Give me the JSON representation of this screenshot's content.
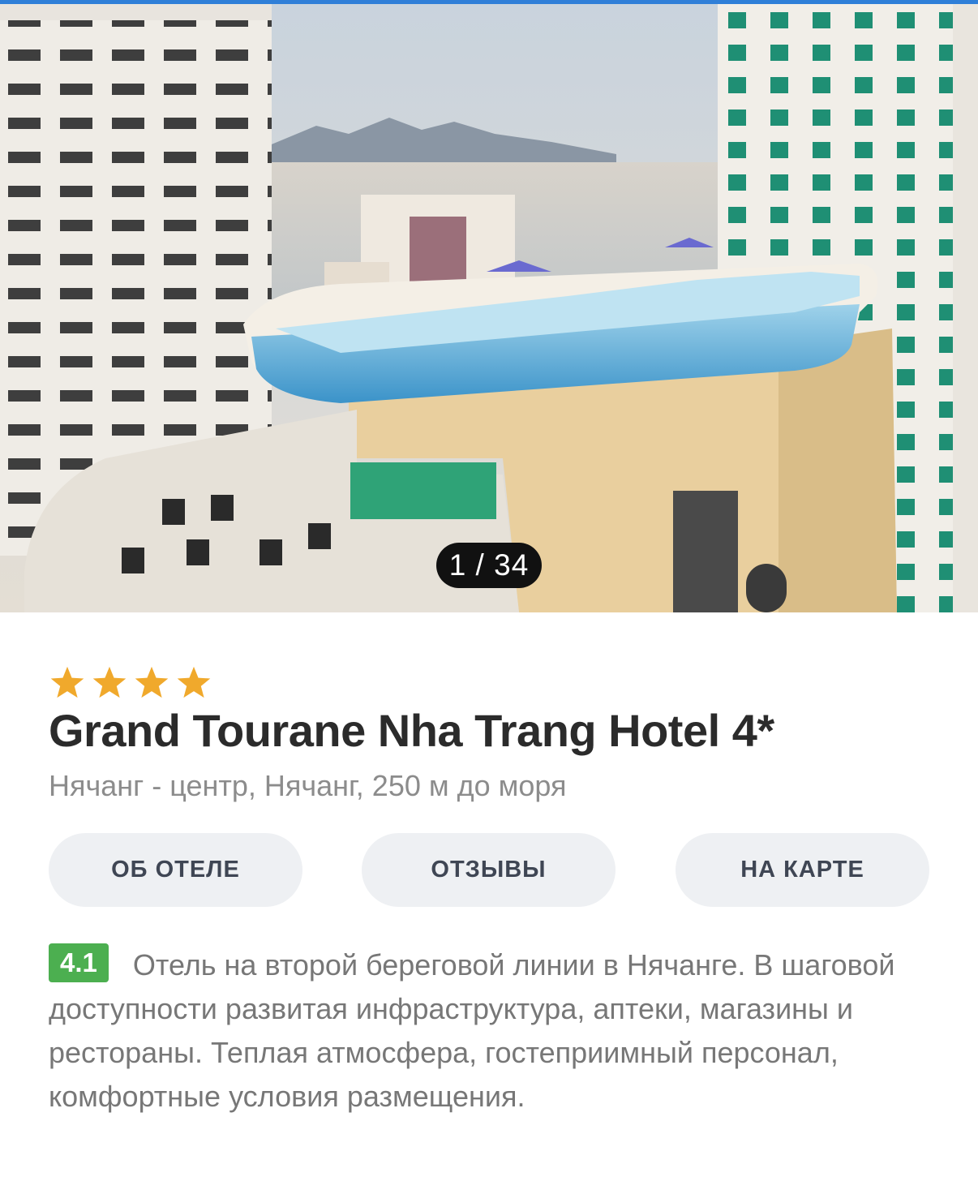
{
  "gallery": {
    "counter": "1 / 34",
    "current": 1,
    "total": 34
  },
  "hotel": {
    "stars": 4,
    "name": "Grand Tourane Nha Trang Hotel 4*",
    "location": "Нячанг - центр, Нячанг, 250 м до моря",
    "rating": "4.1",
    "description": "Отель на второй береговой линии в Нячанге. В шаговой доступности развитая инфраструктура, аптеки, магазины и рестораны. Теплая атмосфера, гостеприимный персонал, комфортные условия размещения."
  },
  "tabs": [
    {
      "label": "ОБ ОТЕЛЕ"
    },
    {
      "label": "ОТЗЫВЫ"
    },
    {
      "label": "НА КАРТЕ"
    }
  ],
  "colors": {
    "star": "#f0a92c",
    "rating_badge": "#4caf50",
    "tab_bg": "#eef0f3",
    "accent_line": "#2f7fd8"
  },
  "icons": [
    "chevron-right-icon",
    "star-icon"
  ]
}
